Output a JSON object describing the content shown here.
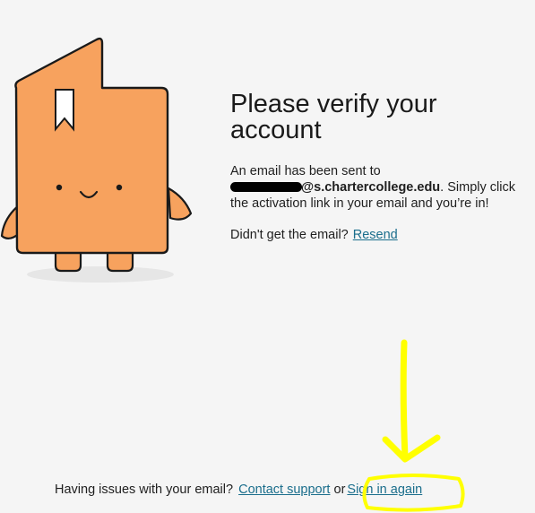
{
  "page": {
    "title": "Please verify your account",
    "sent_prefix": "An email has been sent to",
    "email_domain": "@s.chartercollege.edu",
    "sent_suffix": ". Simply click the activation link in your email and you’re in!",
    "resend_prompt": "Didn't get the email?",
    "resend_link": "Resend"
  },
  "footer": {
    "prefix": "Having issues with your email?",
    "contact_link": "Contact support",
    "or_text": "or",
    "signin_link": "Sign in again"
  },
  "colors": {
    "mascot": "#f7a25e",
    "link": "#1b6e8c",
    "annotation": "#ffff00"
  }
}
